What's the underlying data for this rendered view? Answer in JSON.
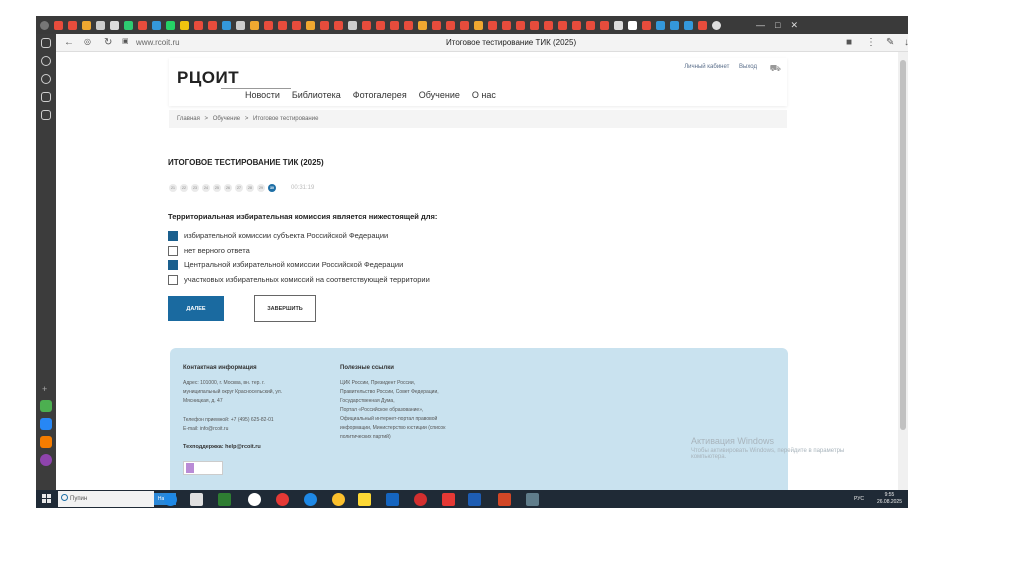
{
  "browser": {
    "url": "www.rcoit.ru",
    "tab_title": "Итоговое тестирование ТИК (2025)"
  },
  "site": {
    "logo": "РЦОИТ",
    "nav": [
      "Новости",
      "Библиотека",
      "Фотогалерея",
      "Обучение",
      "О нас"
    ],
    "user_links": [
      "Личный кабинет",
      "Выход"
    ],
    "breadcrumb": [
      "Главная",
      ">",
      "Обучение",
      ">",
      "Итоговое тестирование"
    ]
  },
  "test": {
    "title": "ИТОГОВОЕ ТЕСТИРОВАНИЕ ТИК (2025)",
    "question_numbers": [
      "21",
      "22",
      "23",
      "24",
      "25",
      "26",
      "27",
      "28",
      "29",
      "30"
    ],
    "current_question": "30",
    "timer": "00:31:19",
    "question": "Территориальная избирательная комиссия является нижестоящей для:",
    "options": [
      {
        "label": "избирательной комиссии субъекта Российской Федерации",
        "checked": true
      },
      {
        "label": "нет верного ответа",
        "checked": false
      },
      {
        "label": "Центральной избирательной комиссии Российской Федерации",
        "checked": true
      },
      {
        "label": "участковых избирательных комиссий на соответствующей территории",
        "checked": false
      }
    ],
    "next_label": "ДАЛЕЕ",
    "finish_label": "ЗАВЕРШИТЬ"
  },
  "footer": {
    "contacts_title": "Контактная информация",
    "address_lines": [
      "Адрес: 101000, г. Москва, вн. тер. г.",
      "муниципальный округ Красносельский, ул.",
      "Мясницкая, д. 47"
    ],
    "phone": "Телефон приемной: +7 (495) 625-82-01",
    "email": "E-mail: info@rcoit.ru",
    "support": "Техподдержка: help@rcoit.ru",
    "links_title": "Полезные ссылки",
    "links_lines": [
      "ЦИК России, Президент России,",
      "Правительство России, Совет Федерации,",
      "Государственная Дума,",
      "Портал «Российское образование»,",
      "Официальный интернет-портал правовой",
      "информации, Министерство юстиции (список",
      "политических партий)"
    ]
  },
  "windows_activation": {
    "title": "Активация Windows",
    "text": "Чтобы активировать Windows, перейдите в параметры компьютера."
  },
  "taskbar": {
    "search_placeholder": "Пупин",
    "search_button": "Найти",
    "lang": "РУС",
    "time": "9:55",
    "date": "26.08.2025"
  },
  "colors": {
    "accent": "#1a6aa0",
    "checkbox_on": "#1a5f8e",
    "footer_bg": "#c9e2ef"
  }
}
